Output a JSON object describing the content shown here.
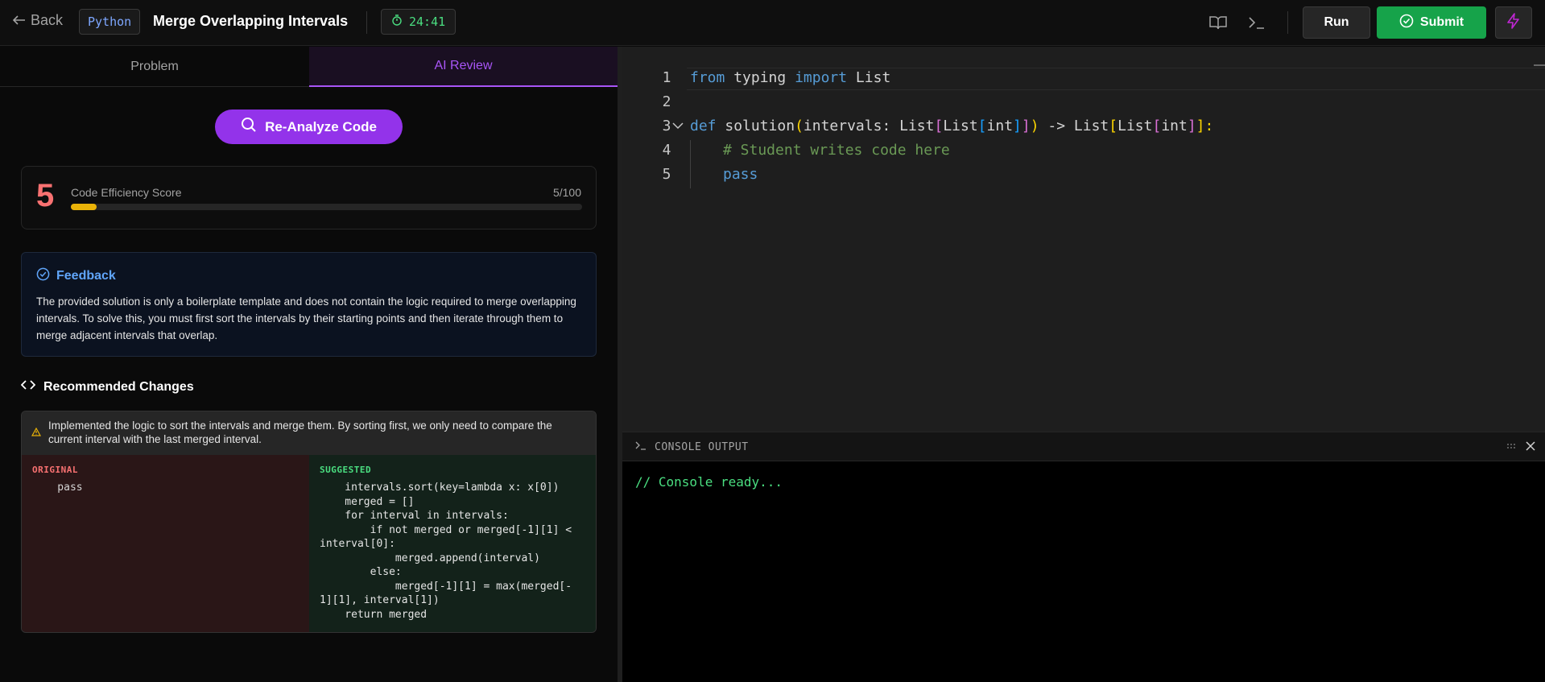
{
  "header": {
    "back_label": "Back",
    "language": "Python",
    "title": "Merge Overlapping Intervals",
    "timer": "24:41",
    "run_label": "Run",
    "submit_label": "Submit"
  },
  "left_panel": {
    "tabs": [
      {
        "label": "Problem",
        "active": false
      },
      {
        "label": "AI Review",
        "active": true
      }
    ],
    "reanalyze_label": "Re-Analyze Code",
    "score": {
      "value": "5",
      "label": "Code Efficiency Score",
      "total_text": "5/100",
      "fraction": 0.05
    },
    "feedback": {
      "heading": "Feedback",
      "text": "The provided solution is only a boilerplate template and does not contain the logic required to merge overlapping intervals. To solve this, you must first sort the intervals by their starting points and then iterate through them to merge adjacent intervals that overlap."
    },
    "recommended": {
      "heading": "Recommended Changes",
      "note": "Implemented the logic to sort the intervals and merge them. By sorting first, we only need to compare the current interval with the last merged interval.",
      "original_label": "ORIGINAL",
      "original_code": "    pass",
      "suggested_label": "SUGGESTED",
      "suggested_code": "    intervals.sort(key=lambda x: x[0])\n    merged = []\n    for interval in intervals:\n        if not merged or merged[-1][1] <\ninterval[0]:\n            merged.append(interval)\n        else:\n            merged[-1][1] = max(merged[-\n1][1], interval[1])\n    return merged"
    }
  },
  "editor": {
    "line_numbers": [
      "1",
      "2",
      "3",
      "4",
      "5"
    ],
    "line1": {
      "kw1": "from",
      "mid": " typing ",
      "kw2": "import",
      "end": " List"
    },
    "line3": {
      "kw": "def",
      "text": " solution(intervals: List[List[int]]) -> List[List[int]]:"
    },
    "line4": "# Student writes code here",
    "line5": "pass"
  },
  "console": {
    "title": "CONSOLE OUTPUT",
    "output": "// Console ready..."
  },
  "colors": {
    "accent_purple": "#9333ea",
    "submit_green": "#16a34a",
    "score_red": "#f87171",
    "progress_yellow": "#eab308",
    "feedback_blue": "#60a5fa"
  }
}
